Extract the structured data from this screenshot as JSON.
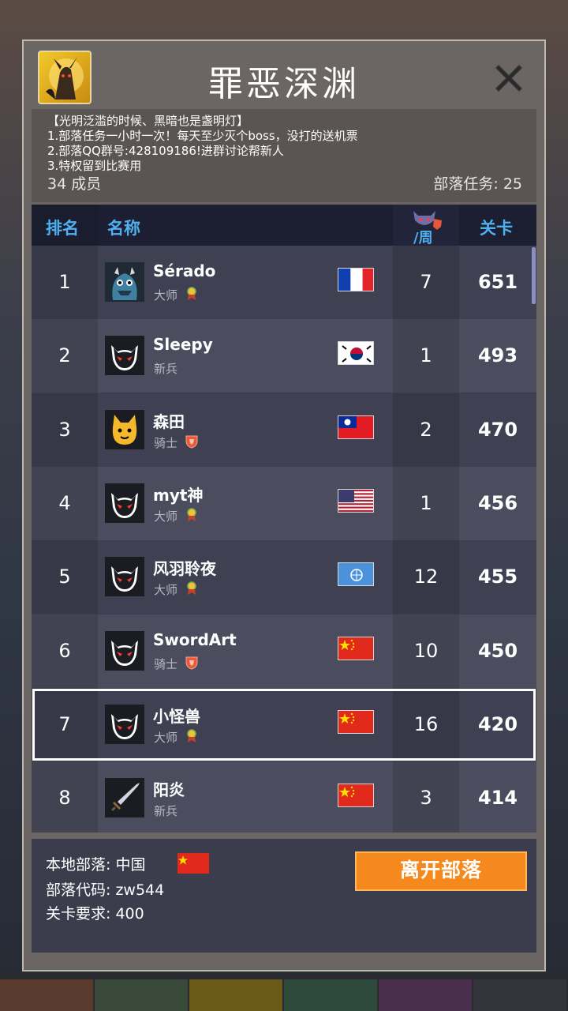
{
  "clan": {
    "name": "罪恶深渊",
    "desc_lines": [
      "【光明泛滥的时候、黑暗也是盏明灯】",
      "1.部落任务一小时一次！每天至少灭个boss，没打的送机票",
      "2.部落QQ群号:428109186!进群讨论帮新人",
      "3.特权留到比赛用"
    ],
    "members": "34 成员",
    "task": "部落任务: 25"
  },
  "table": {
    "headers": {
      "rank": "排名",
      "name": "名称",
      "week": "/周",
      "level": "关卡"
    },
    "rows": [
      {
        "rank": "1",
        "name": "Sérado",
        "role": "大师",
        "badge": "ribbon",
        "flag": "france",
        "week": "7",
        "level": "651",
        "avatar": "monster-avatar"
      },
      {
        "rank": "2",
        "name": "Sleepy",
        "role": "新兵",
        "badge": "",
        "flag": "korea",
        "week": "1",
        "level": "493",
        "avatar": "devil-cat-avatar"
      },
      {
        "rank": "3",
        "name": "森田",
        "role": "骑士",
        "badge": "shield",
        "flag": "taiwan",
        "week": "2",
        "level": "470",
        "avatar": "yellow-fox-avatar"
      },
      {
        "rank": "4",
        "name": "myt神",
        "role": "大师",
        "badge": "ribbon",
        "flag": "usa",
        "week": "1",
        "level": "456",
        "avatar": "devil-cat-avatar"
      },
      {
        "rank": "5",
        "name": "风羽聆夜",
        "role": "大师",
        "badge": "ribbon",
        "flag": "un",
        "week": "12",
        "level": "455",
        "avatar": "devil-cat-avatar"
      },
      {
        "rank": "6",
        "name": "SwordArt",
        "role": "骑士",
        "badge": "shield",
        "flag": "china",
        "week": "10",
        "level": "450",
        "avatar": "devil-cat-avatar"
      },
      {
        "rank": "7",
        "name": "小怪兽",
        "role": "大师",
        "badge": "ribbon",
        "flag": "china",
        "week": "16",
        "level": "420",
        "avatar": "devil-cat-avatar",
        "selected": true
      },
      {
        "rank": "8",
        "name": "阳炎",
        "role": "新兵",
        "badge": "",
        "flag": "china",
        "week": "3",
        "level": "414",
        "avatar": "sword-avatar"
      }
    ]
  },
  "footer": {
    "local_label": "本地部落: 中国",
    "code_label": "部落代码: zw544",
    "req_label": "关卡要求: 400",
    "leave_button": "离开部落"
  },
  "colors": {
    "header_text": "#4fb0f0",
    "leave_button": "#f5891d",
    "row_odd": "#3e4050",
    "row_even": "#4a4c5c"
  }
}
